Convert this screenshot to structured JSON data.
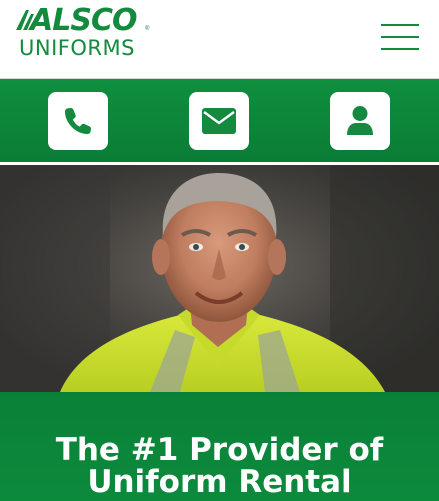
{
  "brand": {
    "name_top": "ALSCO",
    "name_bottom": "UNIFORMS",
    "registered_mark": "®",
    "color": "#138a3e"
  },
  "header": {
    "menu_icon": "hamburger-menu-icon"
  },
  "action_bar": {
    "background": "#0c8a3c",
    "buttons": [
      {
        "icon": "phone-icon"
      },
      {
        "icon": "envelope-icon"
      },
      {
        "icon": "user-icon"
      }
    ]
  },
  "hero": {
    "image": "photo of smiling worker in high-visibility yellow vest"
  },
  "headline": {
    "line1": "The #1 Provider of",
    "line2": "Uniform Rental"
  }
}
